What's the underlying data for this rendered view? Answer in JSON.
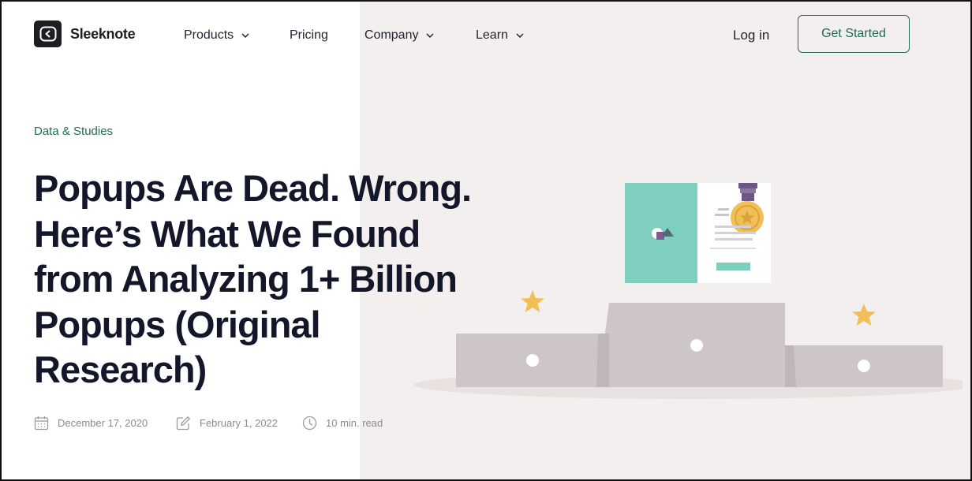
{
  "brand": {
    "name": "Sleeknote"
  },
  "nav": {
    "items": [
      {
        "label": "Products",
        "has_dropdown": true
      },
      {
        "label": "Pricing",
        "has_dropdown": false
      },
      {
        "label": "Company",
        "has_dropdown": true
      },
      {
        "label": "Learn",
        "has_dropdown": true
      }
    ],
    "login_label": "Log in",
    "cta_label": "Get Started"
  },
  "article": {
    "category": "Data & Studies",
    "title": "Popups Are Dead. Wrong. Here’s What We Found from Analyzing 1+ Billion Popups (Original Research)",
    "published": "December 17, 2020",
    "updated": "February 1, 2022",
    "read_time": "10 min. read"
  },
  "icons": {
    "logo": "sleeknote-logo-icon",
    "published": "calendar-icon",
    "updated": "edit-icon",
    "read_time": "clock-icon",
    "dropdown": "chevron-down-icon"
  },
  "colors": {
    "accent": "#1f6b54",
    "hero_background": "#f2efee",
    "title_text": "#14172a",
    "meta_text": "#8a8c93",
    "illustration_teal": "#7ecfc0",
    "illustration_star": "#f1bf55",
    "illustration_podium": "#cdc5c6"
  }
}
